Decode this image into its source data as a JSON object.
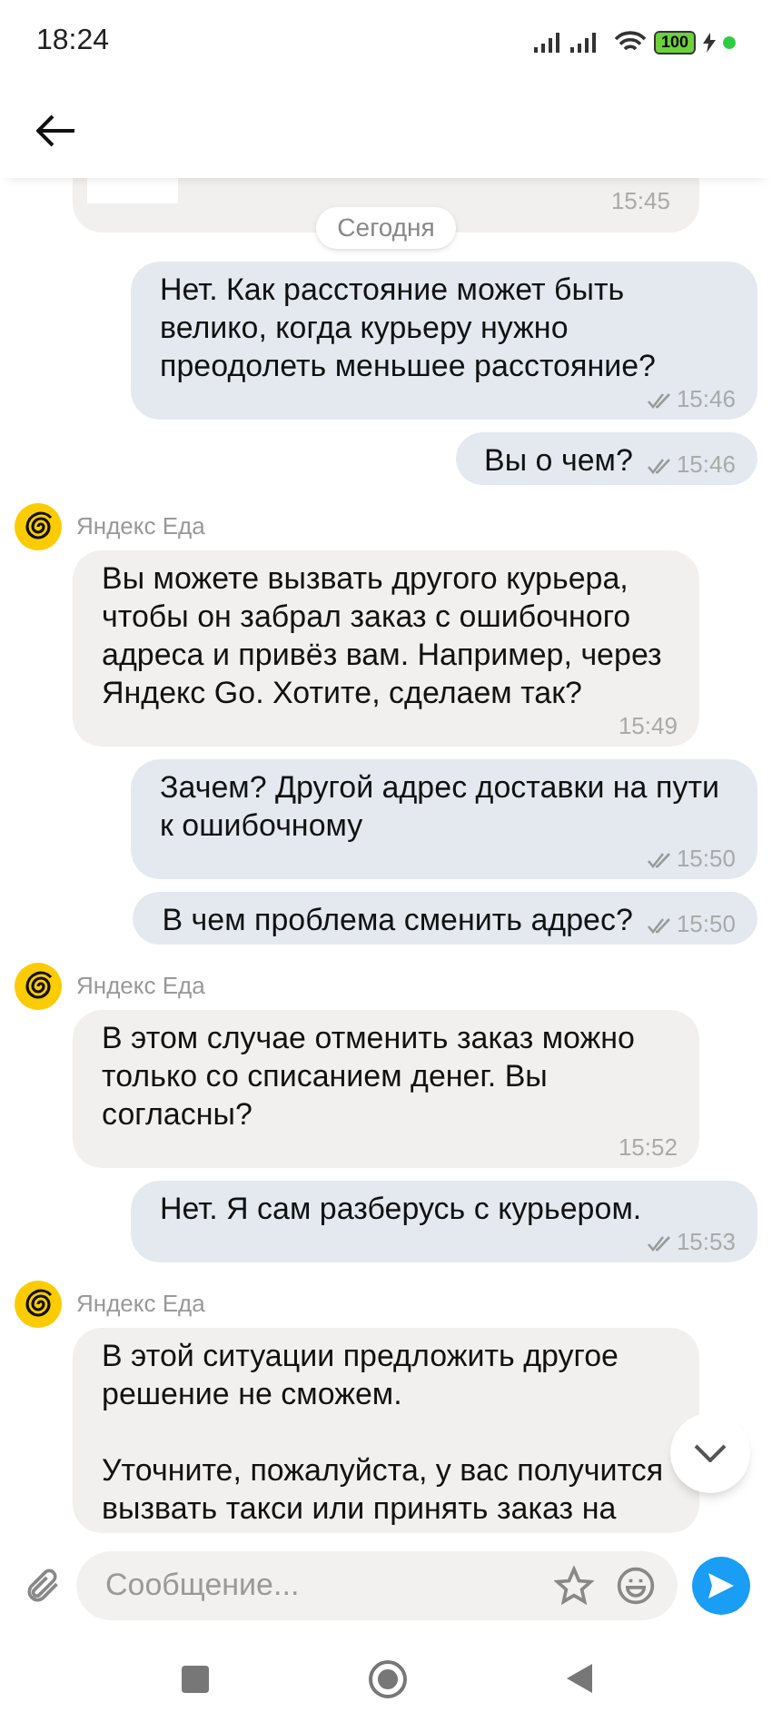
{
  "status_bar": {
    "time": "18:24",
    "battery": "100"
  },
  "messages": [
    {
      "kind": "partial",
      "time": "15:45"
    },
    {
      "kind": "date",
      "text": "Сегодня"
    },
    {
      "kind": "outgoing",
      "text": "Нет. Как расстояние может быть велико, когда курьеру нужно преодолеть меньшее расстояние?",
      "time": "15:46",
      "read": true
    },
    {
      "kind": "outgoing",
      "text": "Вы о чем?",
      "time": "15:46",
      "read": true
    },
    {
      "kind": "incoming",
      "sender": "Яндекс Еда",
      "text": "Вы можете вызвать другого курьера, чтобы он забрал заказ с ошибочного адреса и привёз вам. Например, через Яндекс Go. Хотите, сделаем так?",
      "time": "15:49"
    },
    {
      "kind": "outgoing",
      "text": "Зачем? Другой адрес доставки на пути к ошибочному",
      "time": "15:50",
      "read": true
    },
    {
      "kind": "outgoing",
      "text": "В чем проблема сменить адрес?",
      "time": "15:50",
      "read": true
    },
    {
      "kind": "incoming",
      "sender": "Яндекс Еда",
      "text": "В этом случае отменить заказ можно только со списанием денег. Вы согласны?",
      "time": "15:52"
    },
    {
      "kind": "outgoing",
      "text": "Нет. Я сам разберусь с курьером.",
      "time": "15:53",
      "read": true
    },
    {
      "kind": "incoming",
      "sender": "Яндекс Еда",
      "text": "В этой ситуации предложить другое решение не сможем.\n\nУточните, пожалуйста, у вас получится вызвать такси или принять заказ на"
    }
  ],
  "composer": {
    "placeholder": "Сообщение..."
  }
}
